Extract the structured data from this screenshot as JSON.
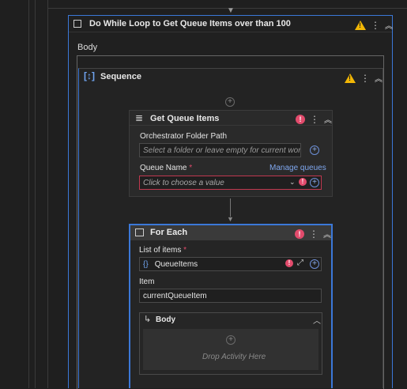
{
  "loop": {
    "title": "Do While Loop  to Get Queue Items over than 100",
    "body_label": "Body"
  },
  "sequence": {
    "title": "Sequence"
  },
  "get_queue": {
    "title": "Get Queue Items",
    "folder_label": "Orchestrator Folder Path",
    "folder_placeholder": "Select a folder or leave empty for current worksp",
    "queue_label": "Queue Name",
    "required_mark": "*",
    "manage_link": "Manage queues",
    "queue_placeholder": "Click to choose a value"
  },
  "for_each": {
    "title": "For Each",
    "list_label": "List of items",
    "required_mark": "*",
    "list_value": "QueueItems",
    "item_label": "Item",
    "item_value": "currentQueueItem",
    "body_title": "Body",
    "drop_text": "Drop Activity Here"
  },
  "colors": {
    "accent_blue": "#3b78d8",
    "error": "#e24b6c",
    "warning": "#f2b705"
  }
}
